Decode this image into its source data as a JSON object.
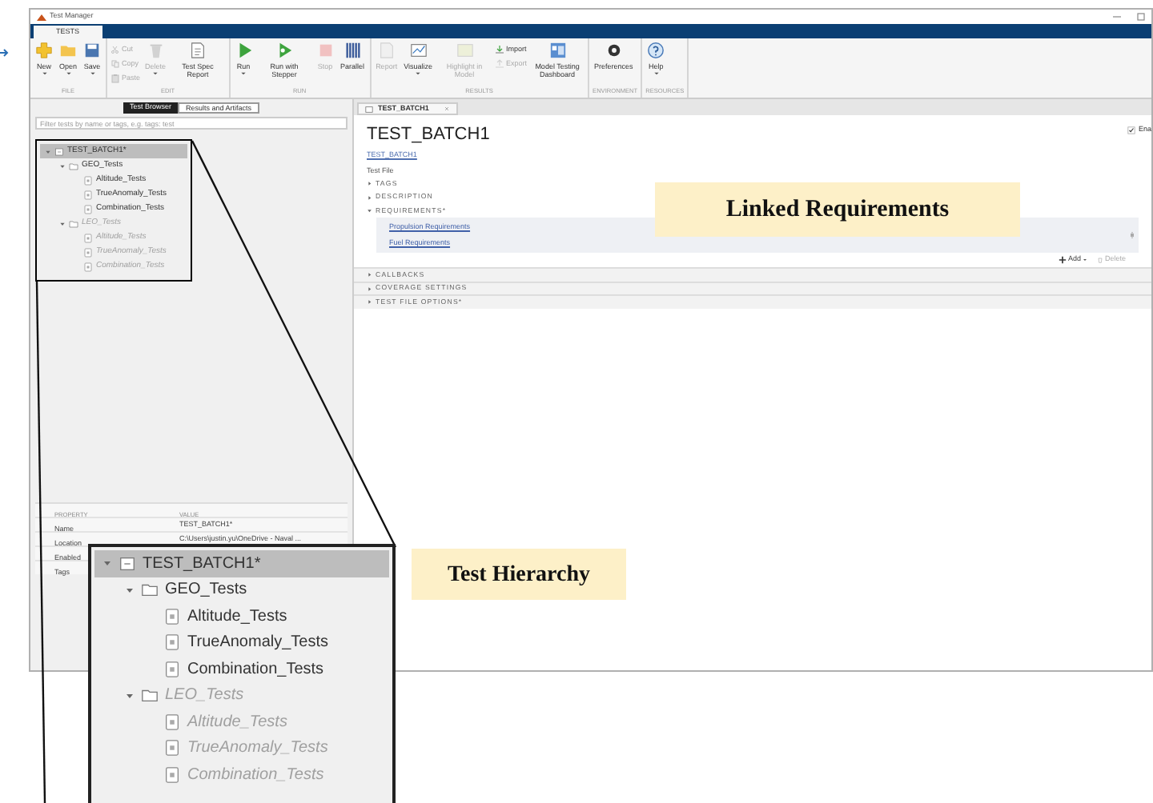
{
  "window": {
    "title": "Test Manager"
  },
  "ribbon": {
    "tabs": [
      {
        "label": "TESTS",
        "selected": true
      }
    ],
    "groups": [
      {
        "label": "FILE",
        "buttons": [
          {
            "label": "New",
            "kind": "large",
            "disabled": false,
            "menu": true
          },
          {
            "label": "Open",
            "kind": "large",
            "disabled": false,
            "menu": true
          },
          {
            "label": "Save",
            "kind": "large",
            "disabled": false,
            "menu": true
          }
        ]
      },
      {
        "label": "EDIT",
        "buttons": [
          {
            "label": "Cut",
            "kind": "small",
            "disabled": true,
            "menu": false
          },
          {
            "label": "Copy",
            "kind": "small",
            "disabled": true,
            "menu": false
          },
          {
            "label": "Paste",
            "kind": "small",
            "disabled": true,
            "menu": false
          },
          {
            "label": "Delete",
            "kind": "large",
            "disabled": true,
            "menu": true
          },
          {
            "label": "Test Spec Report",
            "kind": "large",
            "disabled": false,
            "menu": false
          }
        ]
      },
      {
        "label": "RUN",
        "buttons": [
          {
            "label": "Run",
            "kind": "large",
            "disabled": false,
            "menu": true
          },
          {
            "label": "Run with Stepper",
            "kind": "large",
            "disabled": false,
            "menu": false
          },
          {
            "label": "Stop",
            "kind": "large",
            "disabled": true,
            "menu": false
          },
          {
            "label": "Parallel",
            "kind": "large",
            "disabled": false,
            "menu": false
          }
        ]
      },
      {
        "label": "RESULTS",
        "buttons": [
          {
            "label": "Report",
            "kind": "large",
            "disabled": true,
            "menu": false
          },
          {
            "label": "Visualize",
            "kind": "large",
            "disabled": false,
            "menu": true
          },
          {
            "label": "Highlight in Model",
            "kind": "large",
            "disabled": true,
            "menu": false
          },
          {
            "label": "Import",
            "kind": "small",
            "disabled": false,
            "menu": false
          },
          {
            "label": "Export",
            "kind": "small",
            "disabled": true,
            "menu": false
          },
          {
            "label": "Model Testing Dashboard",
            "kind": "large",
            "disabled": false,
            "menu": false
          }
        ]
      },
      {
        "label": "ENVIRONMENT",
        "buttons": [
          {
            "label": "Preferences",
            "kind": "large",
            "disabled": false,
            "menu": false
          }
        ]
      },
      {
        "label": "RESOURCES",
        "buttons": [
          {
            "label": "Help",
            "kind": "large",
            "disabled": false,
            "menu": true
          }
        ]
      }
    ]
  },
  "browser": {
    "tabs": [
      {
        "label": "Test Browser",
        "selected": true
      },
      {
        "label": "Results and Artifacts",
        "selected": false
      }
    ],
    "filter": {
      "placeholder": "Filter tests by name or tags, e.g. tags: test"
    },
    "tree": [
      {
        "label": "TEST_BATCH1*",
        "kind": "file",
        "expanded": true,
        "selected": true,
        "disabled": false,
        "children": [
          {
            "label": "GEO_Tests",
            "kind": "folder",
            "expanded": true,
            "selected": false,
            "disabled": false,
            "children": [
              {
                "label": "Altitude_Tests",
                "kind": "case",
                "selected": false,
                "disabled": false
              },
              {
                "label": "TrueAnomaly_Tests",
                "kind": "case",
                "selected": false,
                "disabled": false
              },
              {
                "label": "Combination_Tests",
                "kind": "case",
                "selected": false,
                "disabled": false
              }
            ]
          },
          {
            "label": "LEO_Tests",
            "kind": "folder",
            "expanded": true,
            "selected": false,
            "disabled": true,
            "children": [
              {
                "label": "Altitude_Tests",
                "kind": "case",
                "selected": false,
                "disabled": true
              },
              {
                "label": "TrueAnomaly_Tests",
                "kind": "case",
                "selected": false,
                "disabled": true
              },
              {
                "label": "Combination_Tests",
                "kind": "case",
                "selected": false,
                "disabled": true
              }
            ]
          }
        ]
      }
    ]
  },
  "properties": {
    "columns": [
      "PROPERTY",
      "VALUE"
    ],
    "rows": [
      {
        "property": "Name",
        "value": "TEST_BATCH1*"
      },
      {
        "property": "Location",
        "value": "C:\\Users\\justin.yu\\OneDrive - Naval ..."
      },
      {
        "property": "Enabled"
      },
      {
        "property": "Tags"
      }
    ]
  },
  "document": {
    "tabs": [
      {
        "label": "TEST_BATCH1",
        "selected": true
      }
    ],
    "title": "TEST_BATCH1",
    "link": "TEST_BATCH1",
    "type": "Test File",
    "enabled_toggle": {
      "label": "Ena",
      "checked": true
    },
    "sections": [
      {
        "label": "TAGS",
        "expanded": false
      },
      {
        "label": "DESCRIPTION",
        "expanded": false
      },
      {
        "label": "REQUIREMENTS*",
        "expanded": true,
        "items": [
          "Propulsion Requirements",
          "Fuel Requirements"
        ],
        "actions": [
          "Add",
          "Delete"
        ]
      },
      {
        "label": "CALLBACKS",
        "expanded": false
      },
      {
        "label": "COVERAGE SETTINGS",
        "expanded": false
      },
      {
        "label": "TEST FILE OPTIONS*",
        "expanded": false
      }
    ]
  },
  "callouts": [
    "Linked Requirements",
    "Test Hierarchy"
  ],
  "inset": {
    "tree": [
      {
        "label": "TEST_BATCH1*",
        "kind": "file",
        "expanded": true,
        "selected": true,
        "disabled": false,
        "children": [
          {
            "label": "GEO_Tests",
            "kind": "folder",
            "expanded": true,
            "selected": false,
            "disabled": false,
            "children": [
              {
                "label": "Altitude_Tests",
                "kind": "case",
                "selected": false,
                "disabled": false
              },
              {
                "label": "TrueAnomaly_Tests",
                "kind": "case",
                "selected": false,
                "disabled": false
              },
              {
                "label": "Combination_Tests",
                "kind": "case",
                "selected": false,
                "disabled": false
              }
            ]
          },
          {
            "label": "LEO_Tests",
            "kind": "folder",
            "expanded": true,
            "selected": false,
            "disabled": true,
            "children": [
              {
                "label": "Altitude_Tests",
                "kind": "case",
                "selected": false,
                "disabled": true
              },
              {
                "label": "TrueAnomaly_Tests",
                "kind": "case",
                "selected": false,
                "disabled": true
              },
              {
                "label": "Combination_Tests",
                "kind": "case",
                "selected": false,
                "disabled": true
              }
            ]
          }
        ]
      }
    ]
  }
}
